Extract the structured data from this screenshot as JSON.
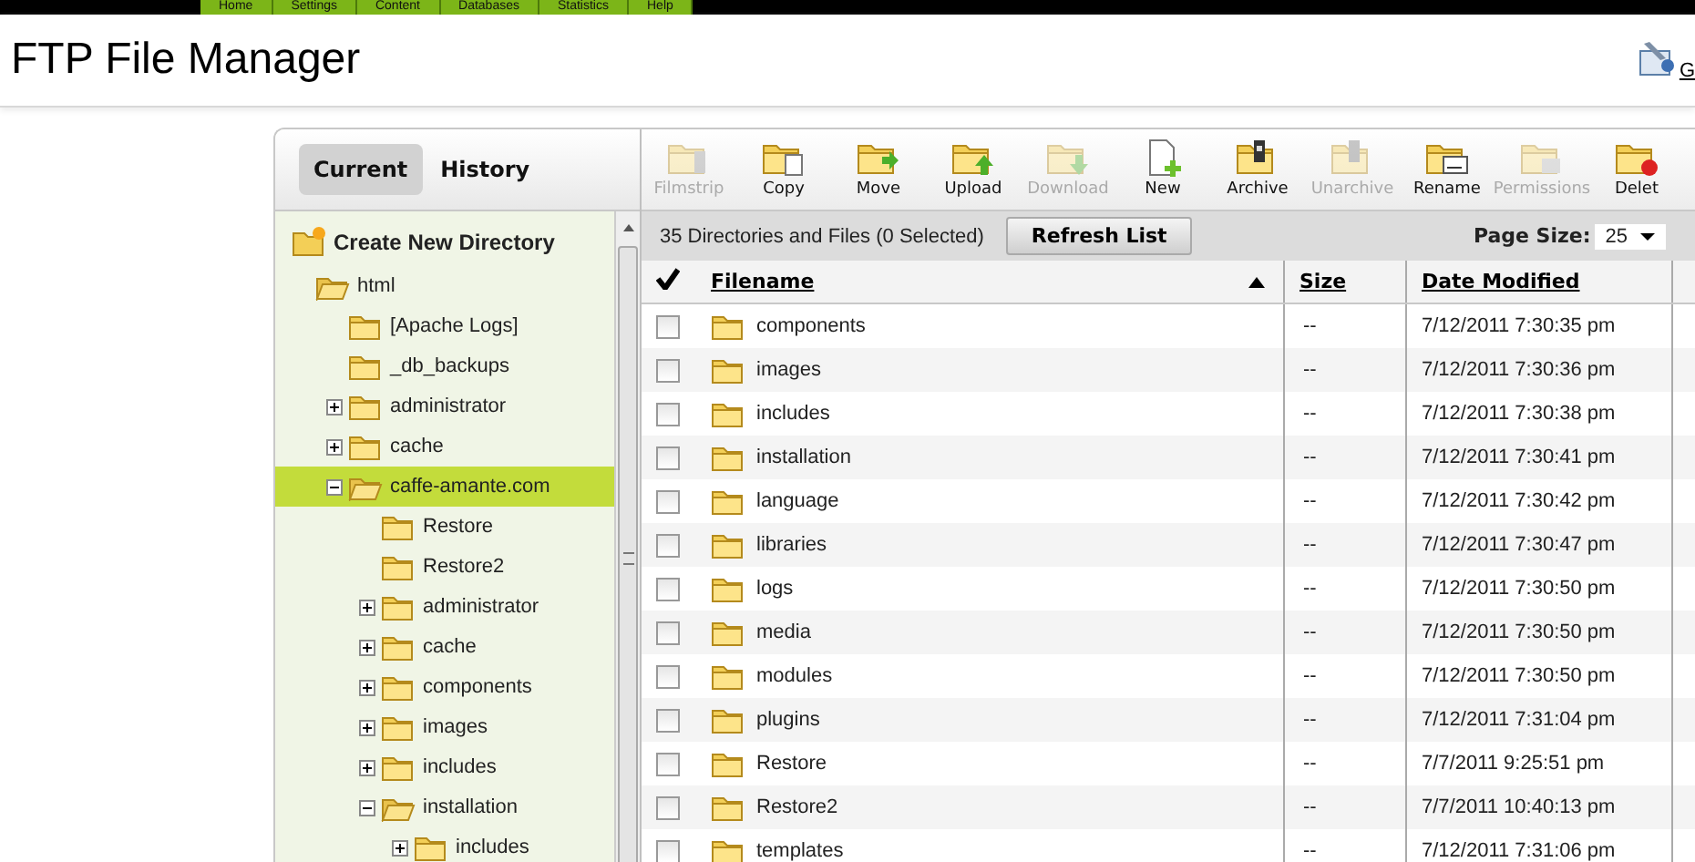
{
  "nav_tabs": [
    "Home",
    "Settings",
    "Content",
    "Databases",
    "Statistics",
    "Help"
  ],
  "page_title": "FTP File Manager",
  "header_link": "G",
  "view_tabs": [
    {
      "label": "Current",
      "selected": true
    },
    {
      "label": "History",
      "selected": false
    }
  ],
  "create_directory": "Create New Directory",
  "tree": [
    {
      "label": "html",
      "expanded": true,
      "expandable": false,
      "selected": false,
      "children": [
        {
          "label": "[Apache Logs]",
          "expandable": false,
          "expanded": false,
          "selected": false
        },
        {
          "label": "_db_backups",
          "expandable": false,
          "expanded": false,
          "selected": false
        },
        {
          "label": "administrator",
          "expandable": true,
          "expanded": false,
          "selected": false
        },
        {
          "label": "cache",
          "expandable": true,
          "expanded": false,
          "selected": false
        },
        {
          "label": "caffe-amante.com",
          "expandable": true,
          "expanded": true,
          "selected": true,
          "children": [
            {
              "label": "Restore",
              "expandable": false,
              "expanded": false,
              "selected": false
            },
            {
              "label": "Restore2",
              "expandable": false,
              "expanded": false,
              "selected": false
            },
            {
              "label": "administrator",
              "expandable": true,
              "expanded": false,
              "selected": false
            },
            {
              "label": "cache",
              "expandable": true,
              "expanded": false,
              "selected": false
            },
            {
              "label": "components",
              "expandable": true,
              "expanded": false,
              "selected": false
            },
            {
              "label": "images",
              "expandable": true,
              "expanded": false,
              "selected": false
            },
            {
              "label": "includes",
              "expandable": true,
              "expanded": false,
              "selected": false
            },
            {
              "label": "installation",
              "expandable": true,
              "expanded": true,
              "selected": false,
              "children": [
                {
                  "label": "includes",
                  "expandable": true,
                  "expanded": false,
                  "selected": false
                }
              ]
            }
          ]
        }
      ]
    }
  ],
  "toolbar": [
    {
      "label": "Filmstrip",
      "kind": "filmstrip",
      "disabled": true
    },
    {
      "label": "Copy",
      "kind": "copy",
      "disabled": false
    },
    {
      "label": "Move",
      "kind": "move",
      "disabled": false
    },
    {
      "label": "Upload",
      "kind": "upload",
      "disabled": false
    },
    {
      "label": "Download",
      "kind": "download",
      "disabled": true
    },
    {
      "label": "New",
      "kind": "new",
      "disabled": false
    },
    {
      "label": "Archive",
      "kind": "archive",
      "disabled": false
    },
    {
      "label": "Unarchive",
      "kind": "unarchive",
      "disabled": true
    },
    {
      "label": "Rename",
      "kind": "rename",
      "disabled": false
    },
    {
      "label": "Permissions",
      "kind": "permissions",
      "disabled": true
    },
    {
      "label": "Delet",
      "kind": "delete",
      "disabled": false
    }
  ],
  "summary": "35 Directories and Files (0 Selected)",
  "refresh_button": "Refresh List",
  "page_size": {
    "label": "Page Size:",
    "value": "25"
  },
  "table": {
    "columns": [
      {
        "label": "Filename",
        "sorted": true
      },
      {
        "label": "Size",
        "sorted": false
      },
      {
        "label": "Date Modified",
        "sorted": false
      }
    ],
    "rows": [
      {
        "name": "components",
        "size": "--",
        "date": "7/12/2011 7:30:35 pm",
        "checked": false
      },
      {
        "name": "images",
        "size": "--",
        "date": "7/12/2011 7:30:36 pm",
        "checked": false
      },
      {
        "name": "includes",
        "size": "--",
        "date": "7/12/2011 7:30:38 pm",
        "checked": false
      },
      {
        "name": "installation",
        "size": "--",
        "date": "7/12/2011 7:30:41 pm",
        "checked": false
      },
      {
        "name": "language",
        "size": "--",
        "date": "7/12/2011 7:30:42 pm",
        "checked": false
      },
      {
        "name": "libraries",
        "size": "--",
        "date": "7/12/2011 7:30:47 pm",
        "checked": false
      },
      {
        "name": "logs",
        "size": "--",
        "date": "7/12/2011 7:30:50 pm",
        "checked": false
      },
      {
        "name": "media",
        "size": "--",
        "date": "7/12/2011 7:30:50 pm",
        "checked": false
      },
      {
        "name": "modules",
        "size": "--",
        "date": "7/12/2011 7:30:50 pm",
        "checked": false
      },
      {
        "name": "plugins",
        "size": "--",
        "date": "7/12/2011 7:31:04 pm",
        "checked": false
      },
      {
        "name": "Restore",
        "size": "--",
        "date": "7/7/2011 9:25:51 pm",
        "checked": false
      },
      {
        "name": "Restore2",
        "size": "--",
        "date": "7/7/2011 10:40:13 pm",
        "checked": false
      },
      {
        "name": "templates",
        "size": "--",
        "date": "7/12/2011 7:31:06 pm",
        "checked": false
      }
    ]
  }
}
